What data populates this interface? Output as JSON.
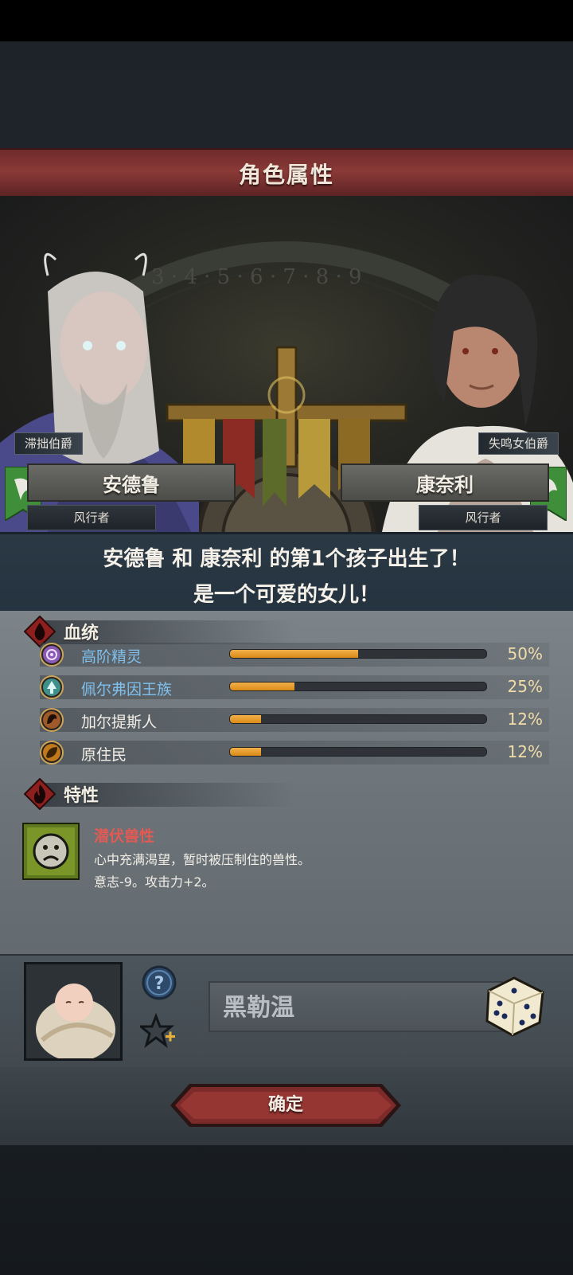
{
  "header": {
    "title": "角色属性"
  },
  "father": {
    "title": "滞拙伯爵",
    "name": "安德鲁",
    "class": "风行者"
  },
  "mother": {
    "title": "失鸣女伯爵",
    "name": "康奈利",
    "class": "风行者"
  },
  "birth": {
    "line1": "安德鲁 和 康奈利 的第1个孩子出生了！",
    "line2": "是一个可爱的女儿！"
  },
  "lineage": {
    "heading": "血统",
    "items": [
      {
        "name": "高阶精灵",
        "percent": "50%",
        "fraction": 0.5,
        "name_color": "#7fc0ee",
        "icon": "high-elf-icon",
        "icon_color": "#8a5bb5"
      },
      {
        "name": "佩尔弗因王族",
        "percent": "25%",
        "fraction": 0.25,
        "name_color": "#7fc0ee",
        "icon": "royal-tree-icon",
        "icon_color": "#3f8f8a"
      },
      {
        "name": "加尔提斯人",
        "percent": "12%",
        "fraction": 0.12,
        "name_color": "#f2eee6",
        "icon": "beast-icon",
        "icon_color": "#a05a2a"
      },
      {
        "name": "原住民",
        "percent": "12%",
        "fraction": 0.12,
        "name_color": "#f2eee6",
        "icon": "leaf-icon",
        "icon_color": "#c07a1c"
      }
    ]
  },
  "traits": {
    "heading": "特性",
    "items": [
      {
        "name": "潜伏兽性",
        "description": "心中充满渴望，暂时被压制住的兽性。",
        "effect": "意志-9。攻击力+2。",
        "icon": "sad-face-icon"
      }
    ]
  },
  "child": {
    "name_value": "黑勒温",
    "help_icon": "question-icon",
    "favorite_icon": "star-plus-icon",
    "random_icon": "dice-icon"
  },
  "footer": {
    "confirm_label": "确定"
  },
  "colors": {
    "accent_red": "#8a3a37",
    "bar_fill": "#e39a22",
    "trait_name": "#e25a54",
    "link_blue": "#7fc0ee"
  }
}
